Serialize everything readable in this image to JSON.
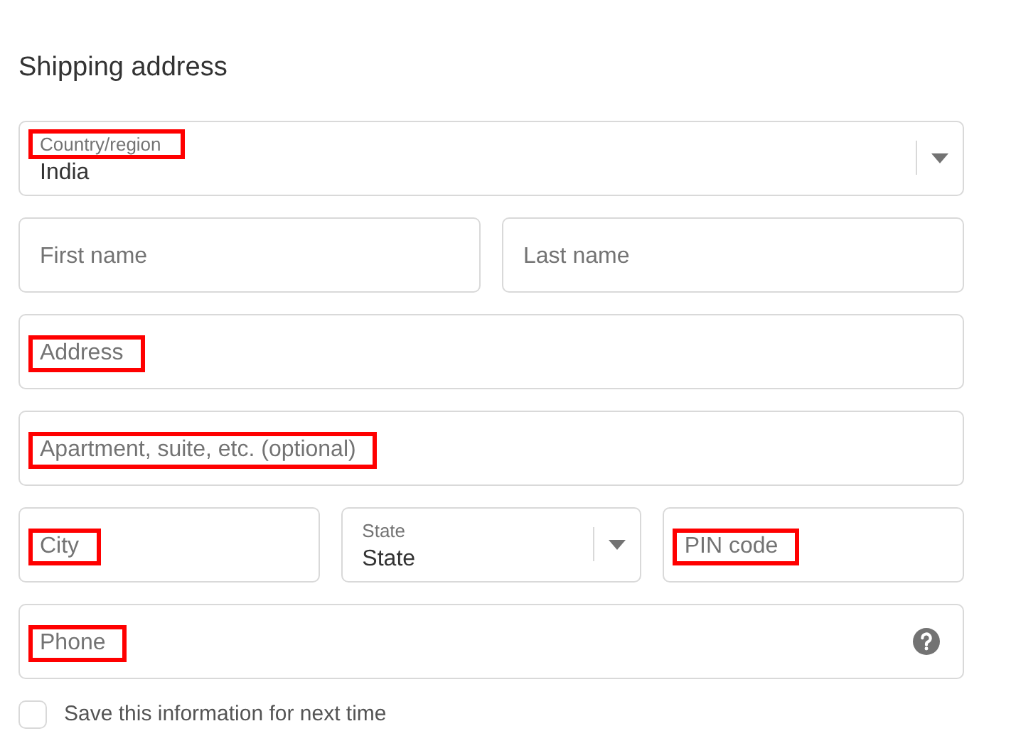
{
  "title": "Shipping address",
  "rows": [
    [
      {
        "kind": "select",
        "label": "Country/region",
        "value": "India",
        "highlighted": true
      }
    ],
    [
      {
        "kind": "text",
        "placeholder": "First name",
        "highlighted": false
      },
      {
        "kind": "text",
        "placeholder": "Last name",
        "highlighted": false
      }
    ],
    [
      {
        "kind": "text",
        "placeholder": "Address",
        "highlighted": true
      }
    ],
    [
      {
        "kind": "text",
        "placeholder": "Apartment, suite, etc. (optional)",
        "highlighted": true
      }
    ],
    [
      {
        "kind": "text",
        "placeholder": "City",
        "highlighted": true
      },
      {
        "kind": "select",
        "label": "State",
        "value": "State",
        "highlighted": false
      },
      {
        "kind": "text",
        "placeholder": "PIN code",
        "highlighted": true
      }
    ],
    [
      {
        "kind": "text",
        "placeholder": "Phone",
        "highlighted": true,
        "help": true
      }
    ]
  ],
  "save": {
    "label": "Save this information for next time",
    "checked": false
  }
}
